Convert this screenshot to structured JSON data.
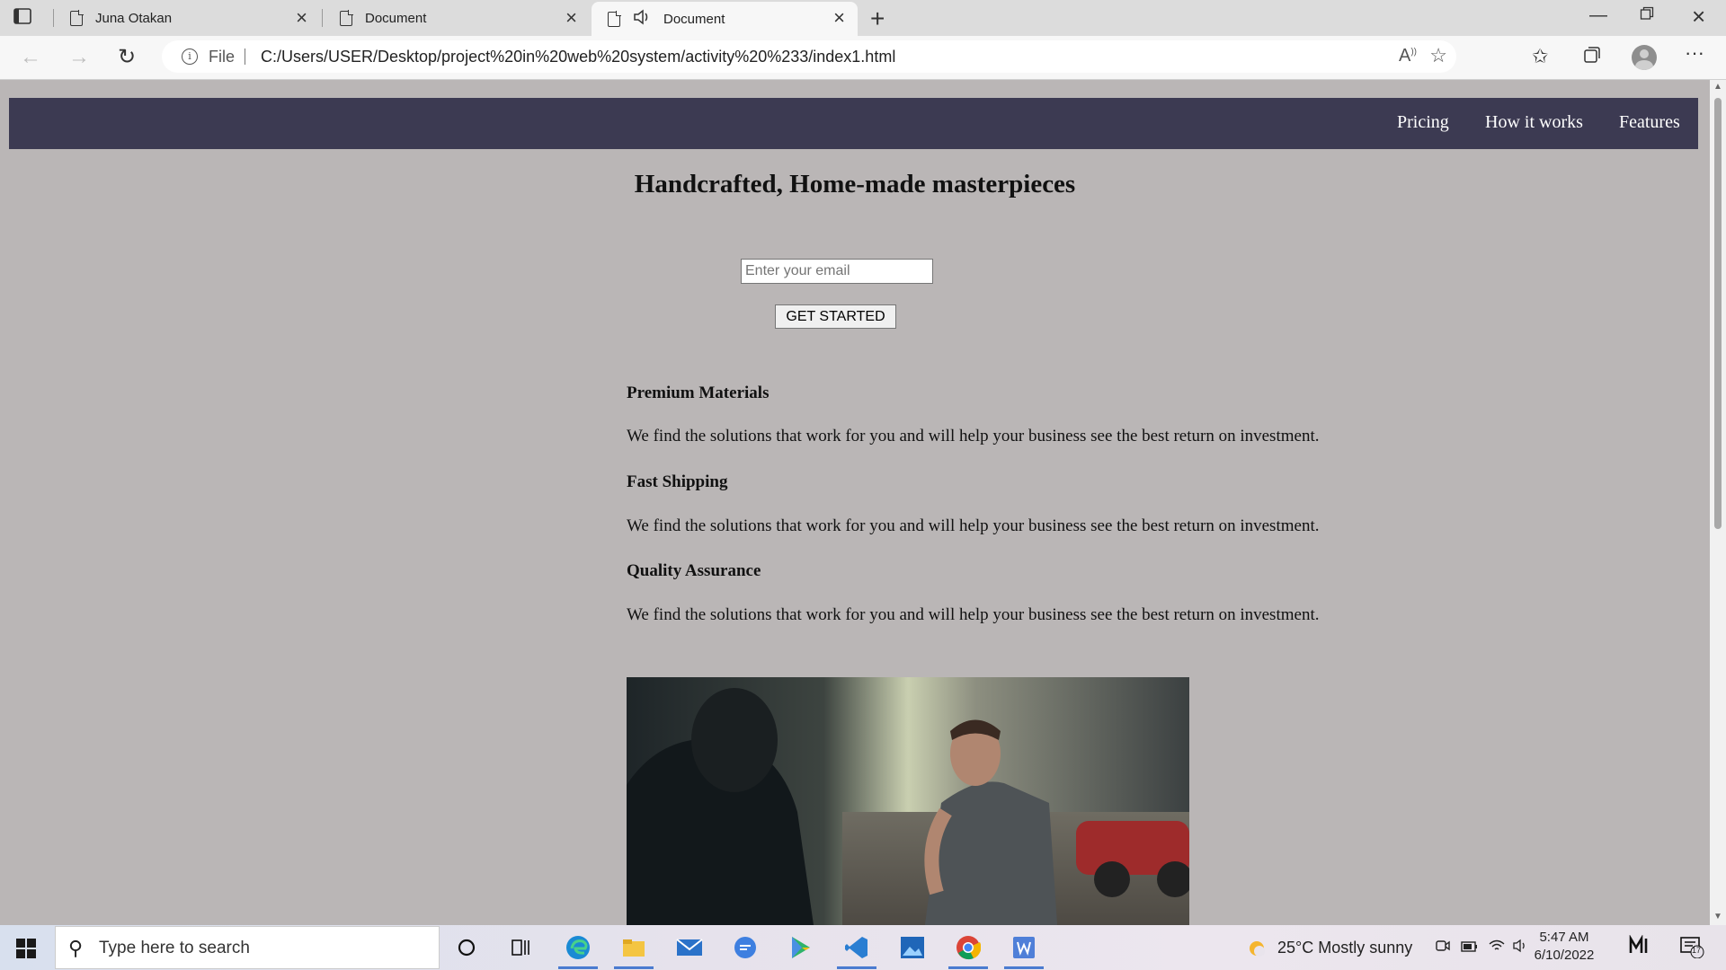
{
  "browser": {
    "tabs": [
      {
        "title": "Juna Otakan",
        "active": false
      },
      {
        "title": "Document",
        "active": false
      },
      {
        "title": "Document",
        "active": true
      }
    ],
    "address": {
      "scheme_label": "File",
      "url": "C:/Users/USER/Desktop/project%20in%20web%20system/activity%20%233/index1.html"
    }
  },
  "page": {
    "nav": [
      "Pricing",
      "How it works",
      "Features"
    ],
    "hero_title": "Handcrafted, Home-made masterpieces",
    "email_placeholder": "Enter your email",
    "cta_label": "GET STARTED",
    "features": [
      {
        "title": "Premium Materials",
        "text": "We find the solutions that work for you and will help your business see the best return on investment."
      },
      {
        "title": "Fast Shipping",
        "text": "We find the solutions that work for you and will help your business see the best return on investment."
      },
      {
        "title": "Quality Assurance",
        "text": "We find the solutions that work for you and will help your business see the best return on investment."
      }
    ]
  },
  "taskbar": {
    "search_placeholder": "Type here to search",
    "weather": "25°C  Mostly sunny",
    "time": "5:47 AM",
    "date": "6/10/2022",
    "notifications": "17"
  },
  "colors": {
    "nav_bg": "#3c3a52",
    "page_bg": "#bab6b6"
  }
}
